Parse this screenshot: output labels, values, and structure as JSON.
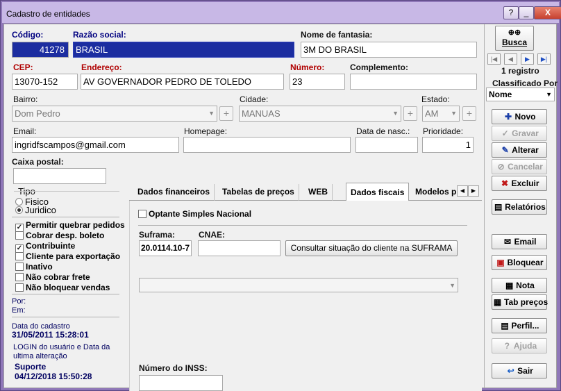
{
  "window": {
    "title": "Cadastro de entidades",
    "help": "?",
    "minimize": "_",
    "close": "X"
  },
  "fields": {
    "codigo": {
      "label": "Código:",
      "value": "41278"
    },
    "razao_social": {
      "label": "Razão social:",
      "value": "BRASIL"
    },
    "nome_fantasia": {
      "label": "Nome de fantasia:",
      "value": "3M DO BRASIL"
    },
    "cep": {
      "label": "CEP:",
      "value": "13070-152"
    },
    "endereco": {
      "label": "Endereço:",
      "value": "AV GOVERNADOR PEDRO DE TOLEDO"
    },
    "numero": {
      "label": "Número:",
      "value": "23"
    },
    "complemento": {
      "label": "Complemento:",
      "value": ""
    },
    "bairro": {
      "label": "Bairro:",
      "value": "Dom Pedro"
    },
    "cidade": {
      "label": "Cidade:",
      "value": "MANUAS"
    },
    "estado": {
      "label": "Estado:",
      "value": "AM"
    },
    "email": {
      "label": "Email:",
      "value": "ingridfscampos@gmail.com"
    },
    "homepage": {
      "label": "Homepage:",
      "value": ""
    },
    "data_nasc": {
      "label": "Data de nasc.:",
      "value": ""
    },
    "prioridade": {
      "label": "Prioridade:",
      "value": "1"
    },
    "caixa_postal": {
      "label": "Caixa postal:",
      "value": ""
    }
  },
  "tipo": {
    "label": "Tipo",
    "options": [
      "Fisico",
      "Juridico"
    ],
    "selected": "Juridico"
  },
  "flags": [
    {
      "label": "Permitir quebrar pedidos",
      "checked": true
    },
    {
      "label": "Cobrar desp. boleto",
      "checked": false
    },
    {
      "label": "Contribuinte",
      "checked": true
    },
    {
      "label": "Cliente para exportação",
      "checked": false
    },
    {
      "label": "Inativo",
      "checked": false
    },
    {
      "label": "Não cobrar frete",
      "checked": false
    },
    {
      "label": "Não bloquear vendas",
      "checked": false
    }
  ],
  "audit": {
    "por": "Por:",
    "em": "Em:",
    "data_cadastro_label": "Data do cadastro",
    "data_cadastro": "31/05/2011 15:28:01",
    "login_label_1": "LOGIN do usuário e Data da",
    "login_label_2": "ultima alteração",
    "login_user": "Suporte",
    "login_date": "04/12/2018 15:50:28"
  },
  "tabs": [
    "Dados financeiros",
    "Tabelas de preços",
    "WEB",
    "Dados fiscais",
    "Modelos p"
  ],
  "active_tab": "Dados fiscais",
  "fiscal": {
    "optante_label": "Optante Simples Nacional",
    "suframa_label": "Suframa:",
    "suframa_value": "20.0114.10-7",
    "cnae_label": "CNAE:",
    "cnae_value": "",
    "consult_button": "Consultar situação do cliente na SUFRAMA",
    "dropdown_value": "",
    "inss_label": "Número do INSS:",
    "inss_value": ""
  },
  "sidebar": {
    "busca": "Busca",
    "registro": "1 registro",
    "classificado_label": "Classificado Por",
    "classificado_value": "Nome",
    "buttons": {
      "novo": "Novo",
      "gravar": "Gravar",
      "alterar": "Alterar",
      "cancelar": "Cancelar",
      "excluir": "Excluir",
      "relatorios": "Relatórios",
      "email": "Email",
      "bloquear": "Bloquear",
      "nota": "Nota",
      "tab_precos": "Tab preços",
      "perfil": "Perfil...",
      "ajuda": "Ajuda",
      "sair": "Sair"
    }
  }
}
